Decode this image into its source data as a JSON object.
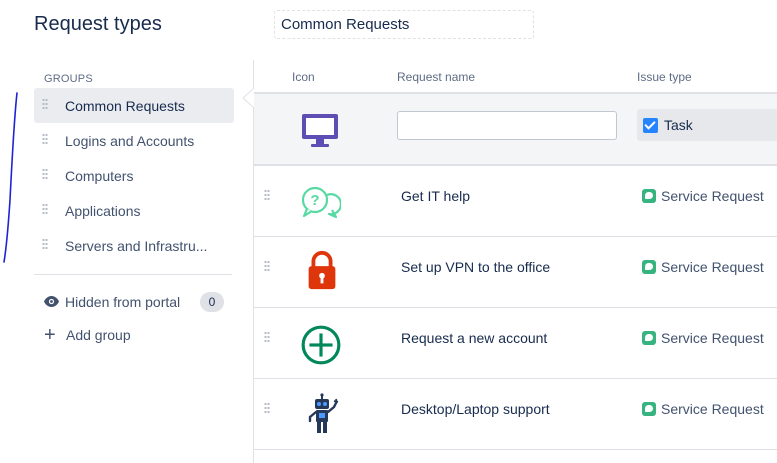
{
  "page": {
    "title": "Request types",
    "group_name_value": "Common Requests"
  },
  "sidebar": {
    "heading": "GROUPS",
    "groups": [
      {
        "label": "Common Requests",
        "active": true
      },
      {
        "label": "Logins and Accounts"
      },
      {
        "label": "Computers"
      },
      {
        "label": "Applications"
      },
      {
        "label": "Servers and Infrastru..."
      }
    ],
    "hidden_label": "Hidden from portal",
    "hidden_count": "0",
    "add_group_label": "Add group"
  },
  "table": {
    "headers": {
      "icon": "Icon",
      "name": "Request name",
      "issue_type": "Issue type"
    },
    "new_row": {
      "name_value": "",
      "issue_type": "Task",
      "icon": "monitor-icon"
    },
    "rows": [
      {
        "name": "Get IT help",
        "issue_type": "Service Request",
        "icon": "chat-question-icon"
      },
      {
        "name": "Set up VPN to the office",
        "issue_type": "Service Request",
        "icon": "padlock-icon"
      },
      {
        "name": "Request a new account",
        "issue_type": "Service Request",
        "icon": "plus-circle-icon"
      },
      {
        "name": "Desktop/Laptop support",
        "issue_type": "Service Request",
        "icon": "robot-icon"
      }
    ]
  },
  "colors": {
    "monitor": "#5e4db2",
    "chat": "#57d9a3",
    "padlock": "#de350b",
    "plus_circle": "#00875a",
    "robot": "#253858",
    "annotation_ink": "#1f23d6"
  }
}
